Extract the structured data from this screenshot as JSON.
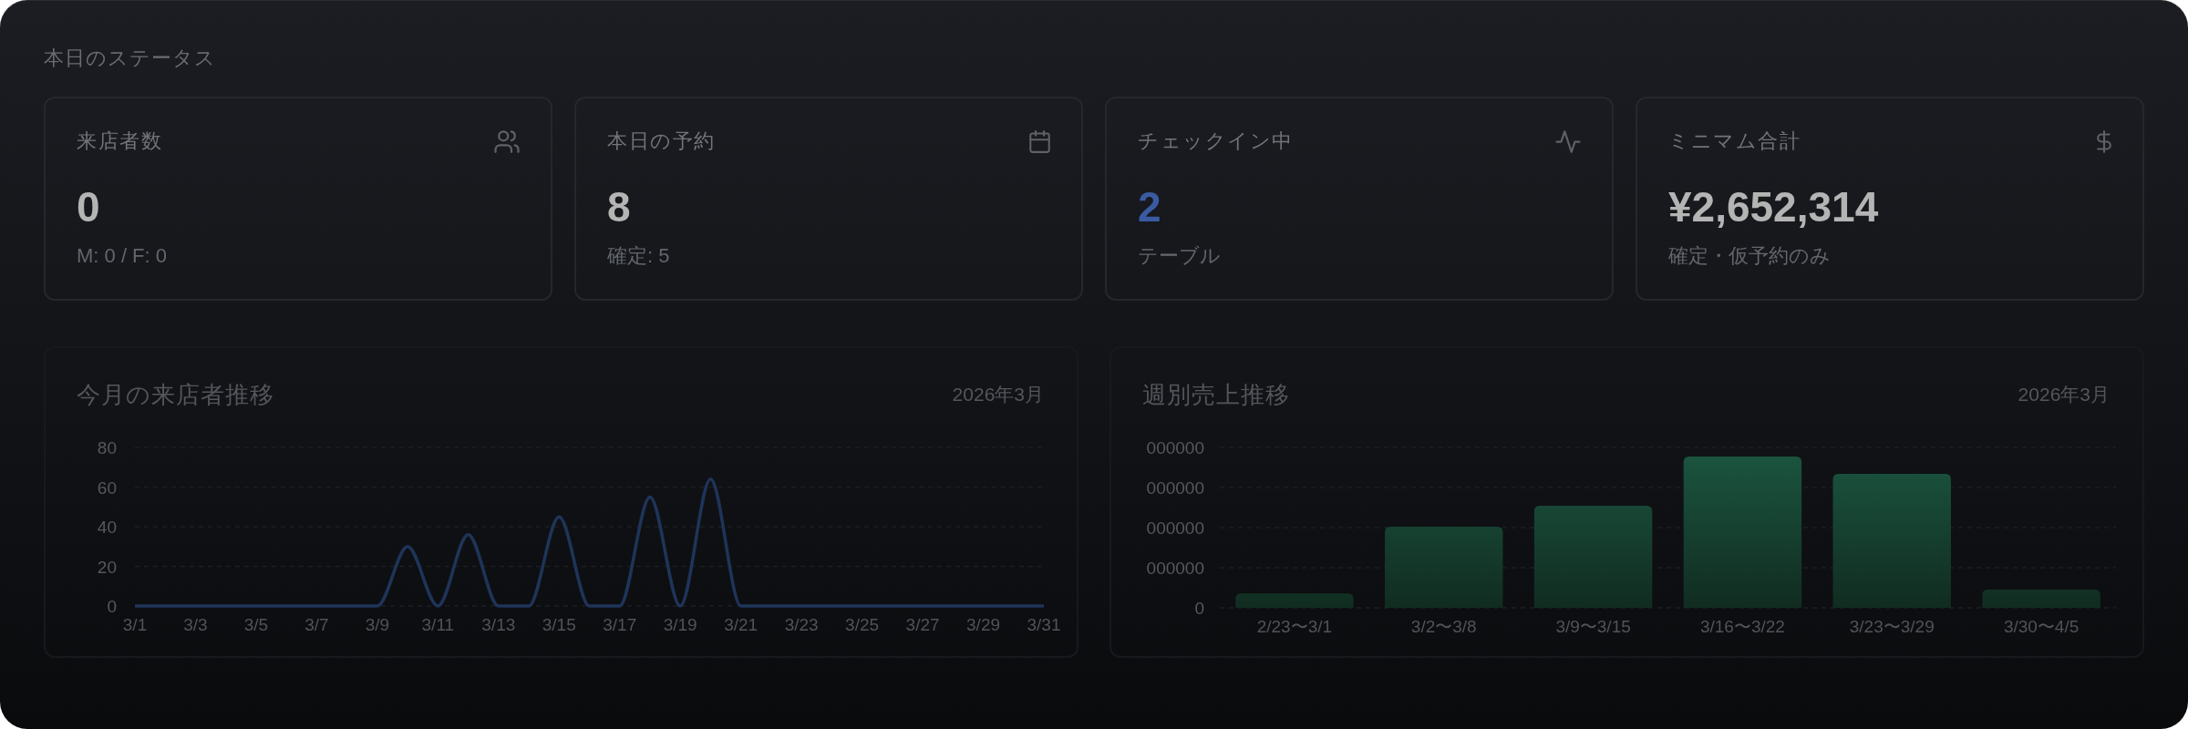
{
  "section_title": "本日のステータス",
  "stats": [
    {
      "label": "来店者数",
      "value": "0",
      "note": "M: 0 / F: 0",
      "color": "#b4b4b4"
    },
    {
      "label": "本日の予約",
      "value": "8",
      "note": "確定: 5",
      "color": "#b4b4b4"
    },
    {
      "label": "チェックイン中",
      "value": "2",
      "note": "テーブル",
      "color": "#3a5ba3"
    },
    {
      "label": "ミニマム合計",
      "value": "¥2,652,314",
      "note": "確定・仮予約のみ",
      "color": "#b4b4b4"
    }
  ],
  "visitor_chart": {
    "title": "今月の来店者推移",
    "period": "2026年3月",
    "chart_data": {
      "type": "line",
      "categories": [
        "3/1",
        null,
        "3/3",
        null,
        "3/5",
        null,
        "3/7",
        null,
        "3/9",
        null,
        "3/11",
        null,
        "3/13",
        null,
        "3/15",
        null,
        "3/17",
        null,
        "3/19",
        null,
        "3/21",
        null,
        "3/23",
        null,
        "3/25",
        null,
        "3/27",
        null,
        "3/29",
        null,
        "3/31"
      ],
      "ylim": [
        0,
        80
      ],
      "yticks": [
        0,
        20,
        40,
        60,
        80
      ],
      "grid": true,
      "series": [
        {
          "color": "#1f3459",
          "values": [
            0,
            0,
            0,
            0,
            0,
            0,
            0,
            0,
            0,
            30,
            0,
            36,
            0,
            0,
            45,
            0,
            0,
            55,
            0,
            64,
            0,
            0,
            0,
            0,
            0,
            0,
            0,
            0,
            0,
            0,
            0
          ]
        }
      ]
    }
  },
  "sales_chart": {
    "title": "週別売上推移",
    "period": "2026年3月",
    "y_axis_labels": [
      "000000",
      "000000",
      "000000",
      "000000",
      "0"
    ],
    "x_axis_labels": [
      "2/23〜3/1",
      "3/2〜3/8",
      "3/9〜3/15",
      "3/16〜3/22",
      "3/23〜3/29",
      "3/30〜4/5"
    ]
  }
}
